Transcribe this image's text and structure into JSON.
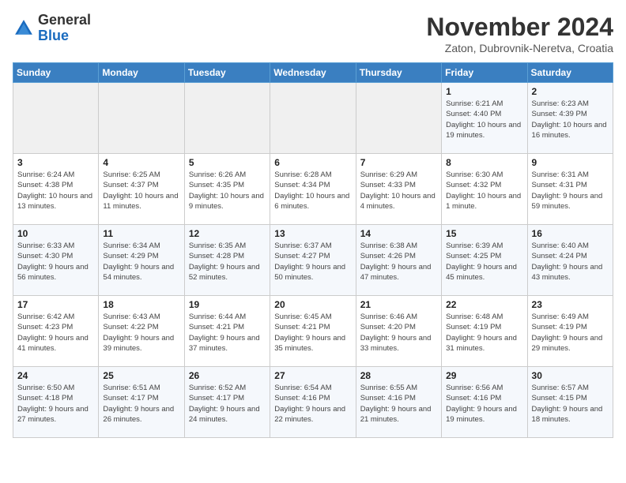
{
  "logo": {
    "general": "General",
    "blue": "Blue"
  },
  "header": {
    "title": "November 2024",
    "location": "Zaton, Dubrovnik-Neretva, Croatia"
  },
  "weekdays": [
    "Sunday",
    "Monday",
    "Tuesday",
    "Wednesday",
    "Thursday",
    "Friday",
    "Saturday"
  ],
  "weeks": [
    [
      {
        "day": "",
        "info": ""
      },
      {
        "day": "",
        "info": ""
      },
      {
        "day": "",
        "info": ""
      },
      {
        "day": "",
        "info": ""
      },
      {
        "day": "",
        "info": ""
      },
      {
        "day": "1",
        "info": "Sunrise: 6:21 AM\nSunset: 4:40 PM\nDaylight: 10 hours and 19 minutes."
      },
      {
        "day": "2",
        "info": "Sunrise: 6:23 AM\nSunset: 4:39 PM\nDaylight: 10 hours and 16 minutes."
      }
    ],
    [
      {
        "day": "3",
        "info": "Sunrise: 6:24 AM\nSunset: 4:38 PM\nDaylight: 10 hours and 13 minutes."
      },
      {
        "day": "4",
        "info": "Sunrise: 6:25 AM\nSunset: 4:37 PM\nDaylight: 10 hours and 11 minutes."
      },
      {
        "day": "5",
        "info": "Sunrise: 6:26 AM\nSunset: 4:35 PM\nDaylight: 10 hours and 9 minutes."
      },
      {
        "day": "6",
        "info": "Sunrise: 6:28 AM\nSunset: 4:34 PM\nDaylight: 10 hours and 6 minutes."
      },
      {
        "day": "7",
        "info": "Sunrise: 6:29 AM\nSunset: 4:33 PM\nDaylight: 10 hours and 4 minutes."
      },
      {
        "day": "8",
        "info": "Sunrise: 6:30 AM\nSunset: 4:32 PM\nDaylight: 10 hours and 1 minute."
      },
      {
        "day": "9",
        "info": "Sunrise: 6:31 AM\nSunset: 4:31 PM\nDaylight: 9 hours and 59 minutes."
      }
    ],
    [
      {
        "day": "10",
        "info": "Sunrise: 6:33 AM\nSunset: 4:30 PM\nDaylight: 9 hours and 56 minutes."
      },
      {
        "day": "11",
        "info": "Sunrise: 6:34 AM\nSunset: 4:29 PM\nDaylight: 9 hours and 54 minutes."
      },
      {
        "day": "12",
        "info": "Sunrise: 6:35 AM\nSunset: 4:28 PM\nDaylight: 9 hours and 52 minutes."
      },
      {
        "day": "13",
        "info": "Sunrise: 6:37 AM\nSunset: 4:27 PM\nDaylight: 9 hours and 50 minutes."
      },
      {
        "day": "14",
        "info": "Sunrise: 6:38 AM\nSunset: 4:26 PM\nDaylight: 9 hours and 47 minutes."
      },
      {
        "day": "15",
        "info": "Sunrise: 6:39 AM\nSunset: 4:25 PM\nDaylight: 9 hours and 45 minutes."
      },
      {
        "day": "16",
        "info": "Sunrise: 6:40 AM\nSunset: 4:24 PM\nDaylight: 9 hours and 43 minutes."
      }
    ],
    [
      {
        "day": "17",
        "info": "Sunrise: 6:42 AM\nSunset: 4:23 PM\nDaylight: 9 hours and 41 minutes."
      },
      {
        "day": "18",
        "info": "Sunrise: 6:43 AM\nSunset: 4:22 PM\nDaylight: 9 hours and 39 minutes."
      },
      {
        "day": "19",
        "info": "Sunrise: 6:44 AM\nSunset: 4:21 PM\nDaylight: 9 hours and 37 minutes."
      },
      {
        "day": "20",
        "info": "Sunrise: 6:45 AM\nSunset: 4:21 PM\nDaylight: 9 hours and 35 minutes."
      },
      {
        "day": "21",
        "info": "Sunrise: 6:46 AM\nSunset: 4:20 PM\nDaylight: 9 hours and 33 minutes."
      },
      {
        "day": "22",
        "info": "Sunrise: 6:48 AM\nSunset: 4:19 PM\nDaylight: 9 hours and 31 minutes."
      },
      {
        "day": "23",
        "info": "Sunrise: 6:49 AM\nSunset: 4:19 PM\nDaylight: 9 hours and 29 minutes."
      }
    ],
    [
      {
        "day": "24",
        "info": "Sunrise: 6:50 AM\nSunset: 4:18 PM\nDaylight: 9 hours and 27 minutes."
      },
      {
        "day": "25",
        "info": "Sunrise: 6:51 AM\nSunset: 4:17 PM\nDaylight: 9 hours and 26 minutes."
      },
      {
        "day": "26",
        "info": "Sunrise: 6:52 AM\nSunset: 4:17 PM\nDaylight: 9 hours and 24 minutes."
      },
      {
        "day": "27",
        "info": "Sunrise: 6:54 AM\nSunset: 4:16 PM\nDaylight: 9 hours and 22 minutes."
      },
      {
        "day": "28",
        "info": "Sunrise: 6:55 AM\nSunset: 4:16 PM\nDaylight: 9 hours and 21 minutes."
      },
      {
        "day": "29",
        "info": "Sunrise: 6:56 AM\nSunset: 4:16 PM\nDaylight: 9 hours and 19 minutes."
      },
      {
        "day": "30",
        "info": "Sunrise: 6:57 AM\nSunset: 4:15 PM\nDaylight: 9 hours and 18 minutes."
      }
    ]
  ]
}
